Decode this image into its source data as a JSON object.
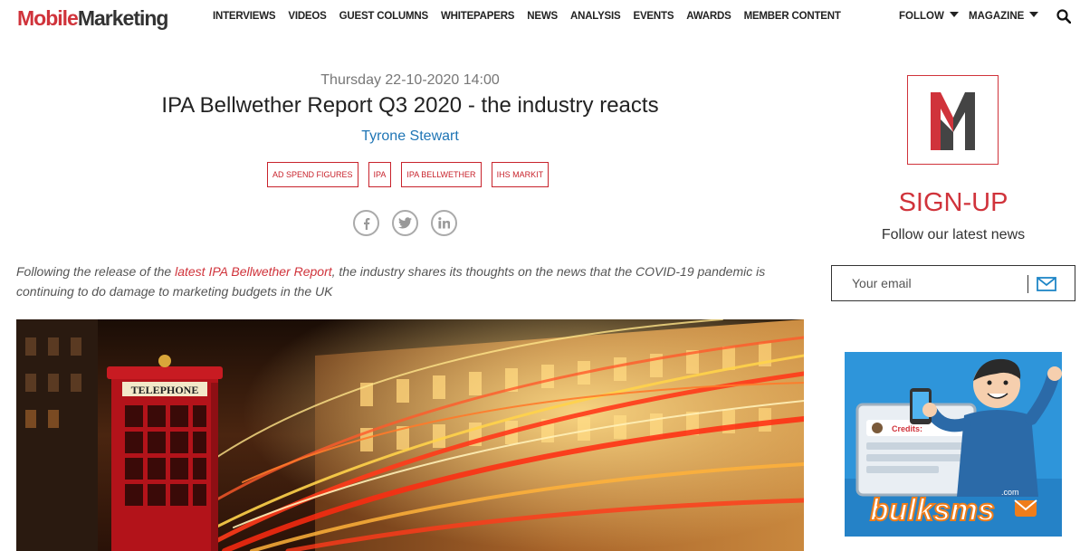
{
  "header": {
    "logo_part1": "Mobile",
    "logo_part2": "Marketing",
    "nav": [
      "INTERVIEWS",
      "VIDEOS",
      "GUEST COLUMNS",
      "WHITEPAPERS",
      "NEWS",
      "ANALYSIS",
      "EVENTS",
      "AWARDS",
      "MEMBER CONTENT"
    ],
    "follow_label": "FOLLOW",
    "magazine_label": "MAGAZINE",
    "search_icon": "search-icon"
  },
  "article": {
    "date": "Thursday 22-10-2020 14:00",
    "title": "IPA Bellwether Report Q3 2020 - the industry reacts",
    "author": "Tyrone Stewart",
    "tags": [
      "AD SPEND FIGURES",
      "IPA",
      "IPA BELLWETHER",
      "IHS MARKIT"
    ],
    "social_icons": [
      "facebook-icon",
      "twitter-icon",
      "linkedin-icon"
    ],
    "intro_before": "Following the release of the ",
    "intro_link": "latest IPA Bellwether Report",
    "intro_after": ", the industry shares its thoughts on the news that the COVID-19 pandemic is continuing to do damage to marketing budgets in the UK",
    "hero_sign": "TELEPHONE"
  },
  "sidebar": {
    "signup_title": "SIGN-UP",
    "signup_sub": "Follow our latest news",
    "email_placeholder": "Your email",
    "ad_brand": "bulksms",
    "ad_brand_suffix": ".com",
    "ad_card_label": "Credits:"
  },
  "colors": {
    "brand_red": "#d0333b",
    "link_blue": "#1f75b5"
  }
}
